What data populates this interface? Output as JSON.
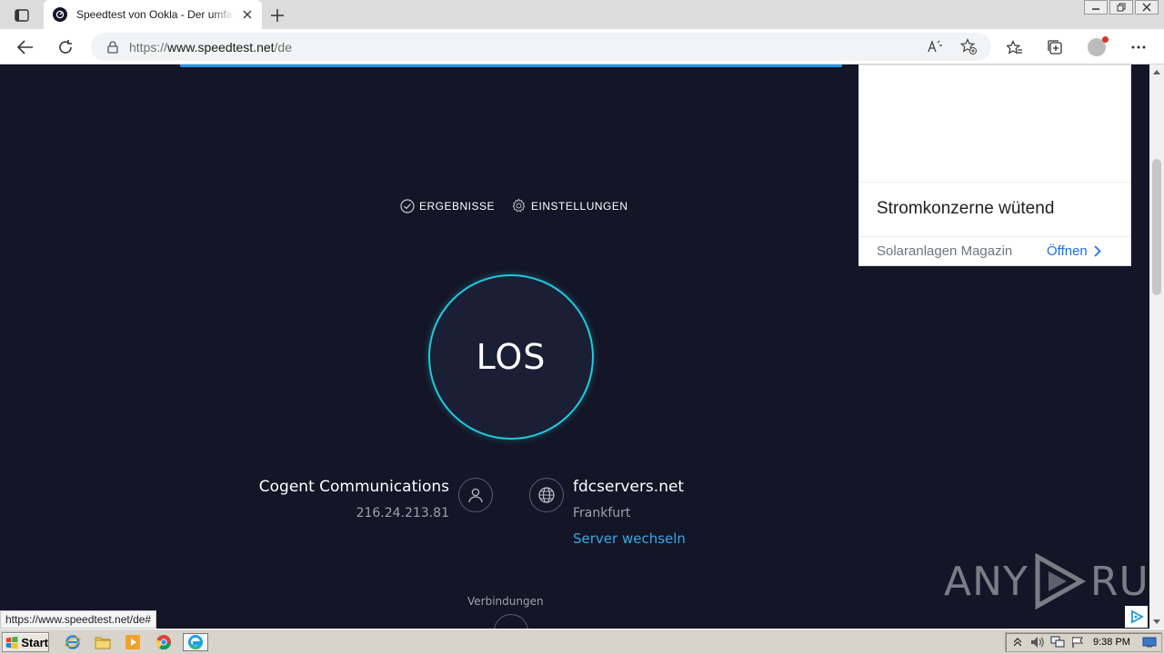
{
  "browser": {
    "tab_title": "Speedtest von Ookla - Der umfassende Geschwindigkeitstest",
    "url_prefix": "https://",
    "url_host": "www.speedtest.net",
    "url_path": "/de",
    "status_url": "https://www.speedtest.net/de#"
  },
  "page": {
    "nav": {
      "results_label": "ERGEBNISSE",
      "settings_label": "EINSTELLUNGEN"
    },
    "go_button_label": "LOS",
    "isp": {
      "name": "Cogent Communications",
      "ip": "216.24.213.81"
    },
    "server": {
      "name": "fdcservers.net",
      "location": "Frankfurt",
      "change_label": "Server wechseln"
    },
    "connections_label": "Verbindungen"
  },
  "ad": {
    "headline": "Stromkonzerne wütend",
    "source": "Solaranlagen Magazin",
    "cta": "Öffnen"
  },
  "watermark": {
    "left": "ANY",
    "right": "RUN"
  },
  "taskbar": {
    "start_label": "Start",
    "clock": "9:38 PM"
  },
  "colors": {
    "page_bg": "#141526",
    "ring": "#22c8de",
    "link": "#39a8e8",
    "ad_cta": "#1a73e8"
  }
}
